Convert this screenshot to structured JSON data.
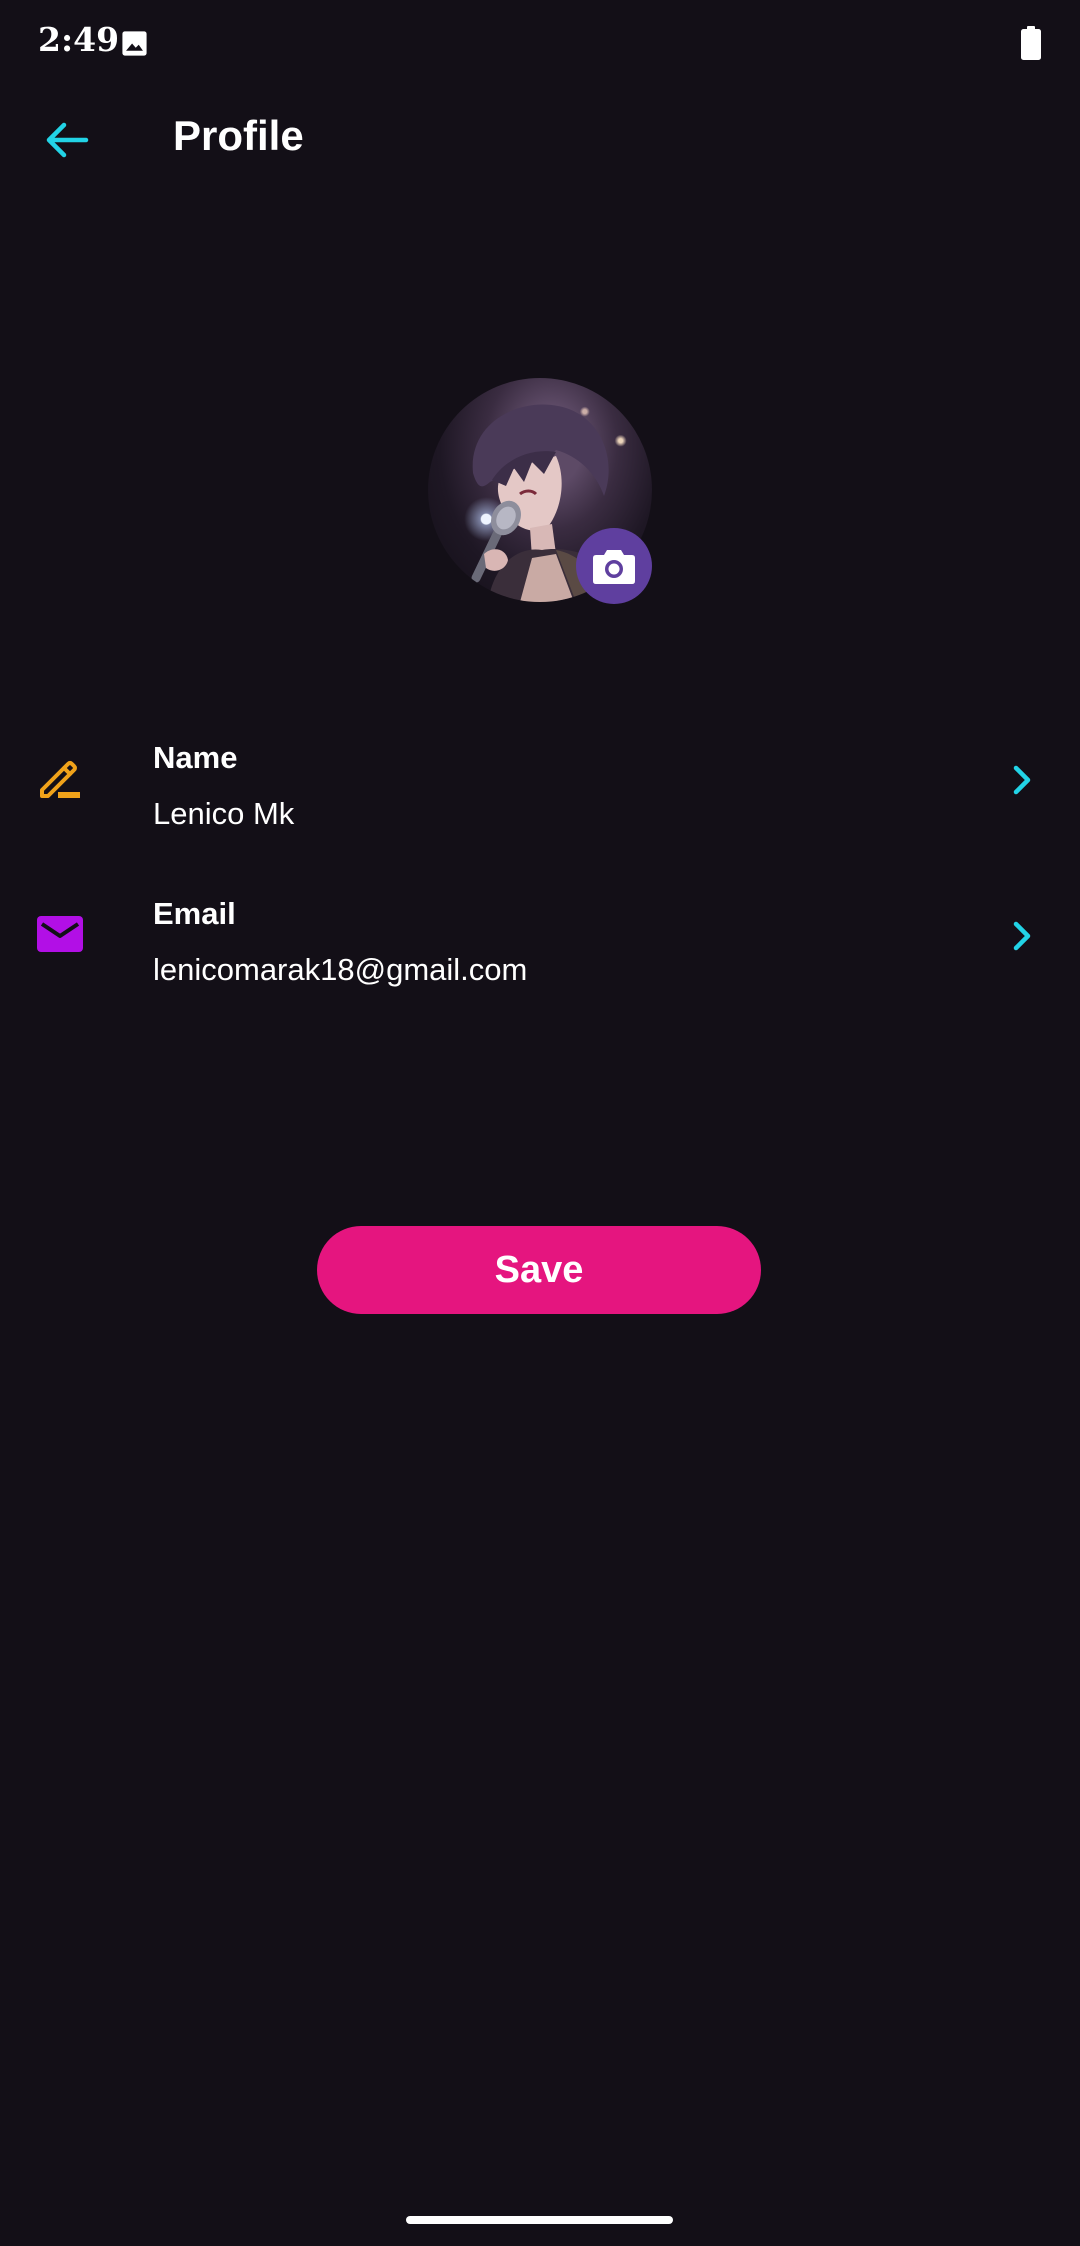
{
  "status_bar": {
    "time": "2:49",
    "icons": [
      "image-icon",
      "battery-icon"
    ]
  },
  "header": {
    "title": "Profile",
    "back_icon": "arrow-left-icon"
  },
  "avatar": {
    "camera_icon": "camera-icon"
  },
  "fields": [
    {
      "label": "Name",
      "value": "Lenico Mk",
      "icon": "pencil-icon",
      "icon_color": "#f0a21a"
    },
    {
      "label": "Email",
      "value": "lenicomarak18@gmail.com",
      "icon": "mail-icon",
      "icon_color": "#b20fe6"
    }
  ],
  "actions": {
    "save_label": "Save"
  },
  "colors": {
    "background": "#130f17",
    "accent": "#22d3e6",
    "save_button": "#e5157f",
    "camera_badge": "#5f3f9f"
  }
}
